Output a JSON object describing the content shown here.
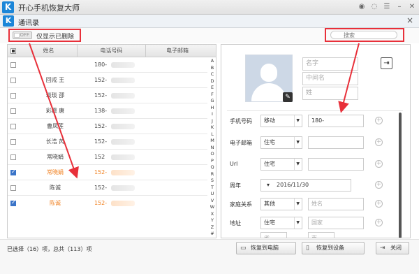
{
  "app": {
    "title": "开心手机恢复大师"
  },
  "panel": {
    "title": "通讯录"
  },
  "filter": {
    "toggle_text": "OFF",
    "label": "仅显示已删除"
  },
  "search": {
    "placeholder": "搜索"
  },
  "table": {
    "headers": [
      "姓名",
      "电话号码",
      "电子邮箱"
    ],
    "rows": [
      {
        "name": "",
        "phone": "180-",
        "checked": false,
        "selected": false
      },
      {
        "name": "回戎 王",
        "phone": "152-",
        "checked": false,
        "selected": false
      },
      {
        "name": "琰琰 邵",
        "phone": "152-",
        "checked": false,
        "selected": false
      },
      {
        "name": "彩霞 唐",
        "phone": "138-",
        "checked": false,
        "selected": false
      },
      {
        "name": "曹凤莲",
        "phone": "152-",
        "checked": false,
        "selected": false
      },
      {
        "name": "长浩 芮",
        "phone": "152-",
        "checked": false,
        "selected": false
      },
      {
        "name": "常晓娟",
        "phone": "152",
        "checked": false,
        "selected": false
      },
      {
        "name": "常晓娟",
        "phone": "152-",
        "checked": true,
        "selected": true
      },
      {
        "name": "陈诚",
        "phone": "152-",
        "checked": false,
        "selected": false
      },
      {
        "name": "陈诚",
        "phone": "152-",
        "checked": true,
        "selected": true
      }
    ]
  },
  "az_index": [
    "A",
    "B",
    "C",
    "D",
    "E",
    "F",
    "G",
    "H",
    "I",
    "J",
    "K",
    "L",
    "M",
    "N",
    "O",
    "P",
    "Q",
    "R",
    "S",
    "T",
    "U",
    "V",
    "W",
    "X",
    "Y",
    "Z",
    "#"
  ],
  "detail": {
    "name_fields": [
      "名字",
      "中间名",
      "姓"
    ],
    "fields": {
      "phone_label": "手机号码",
      "phone_type": "移动",
      "phone_value": "180-",
      "email_label": "电子邮箱",
      "email_type": "住宅",
      "url_label": "Url",
      "url_type": "住宅",
      "anniv_label": "周年",
      "anniv_value": "2016/11/30",
      "family_label": "家庭关系",
      "family_type": "其他",
      "family_placeholder": "姓名",
      "address_label": "地址",
      "address_type": "住宅",
      "country_placeholder": "国家",
      "province_placeholder": "省",
      "city_placeholder": "市"
    }
  },
  "footer": {
    "status": "已选择（16）项，总共（113）项",
    "restore_pc": "恢复到电脑",
    "restore_device": "恢复到设备",
    "close": "关闭"
  }
}
